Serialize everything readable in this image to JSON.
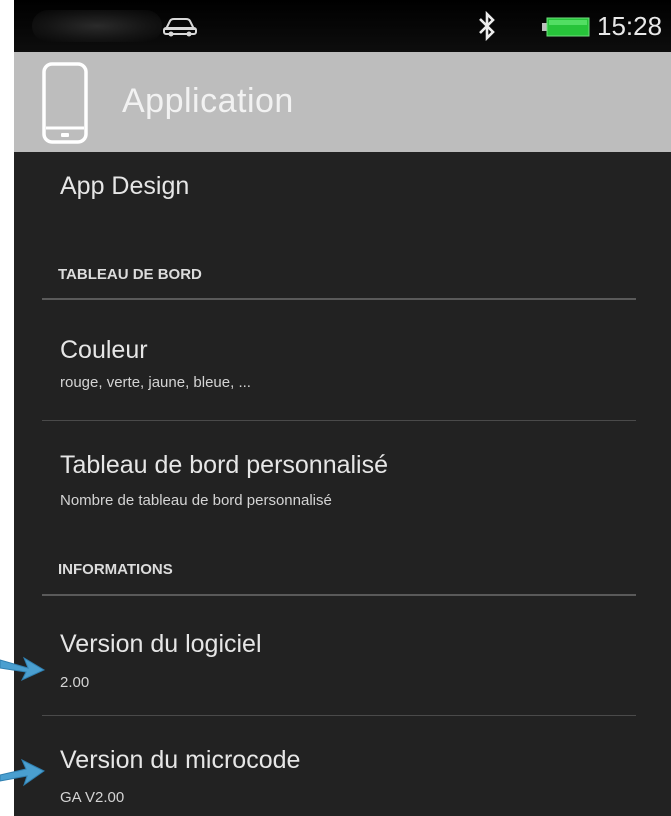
{
  "status_bar": {
    "time": "15:28",
    "icons": [
      "car-icon",
      "bluetooth-icon",
      "battery-icon"
    ],
    "battery_color": "#27c43a"
  },
  "header": {
    "title": "Application",
    "icon": "phone-icon",
    "background": "#bdbdbd"
  },
  "settings": {
    "app_design": {
      "title": "App Design"
    },
    "sections": {
      "dashboard": "TABLEAU DE BORD",
      "info": "INFORMATIONS"
    },
    "color": {
      "title": "Couleur",
      "summary": "rouge, verte, jaune, bleue, ..."
    },
    "custom_dashboard": {
      "title": "Tableau de bord personnalisé",
      "summary": "Nombre de tableau de bord personnalisé"
    },
    "software_version": {
      "title": "Version du logiciel",
      "value": "2.00"
    },
    "firmware_version": {
      "title": "Version du microcode",
      "value": "GA V2.00"
    }
  },
  "annotations": {
    "arrow_color": "#4a9fd0"
  }
}
